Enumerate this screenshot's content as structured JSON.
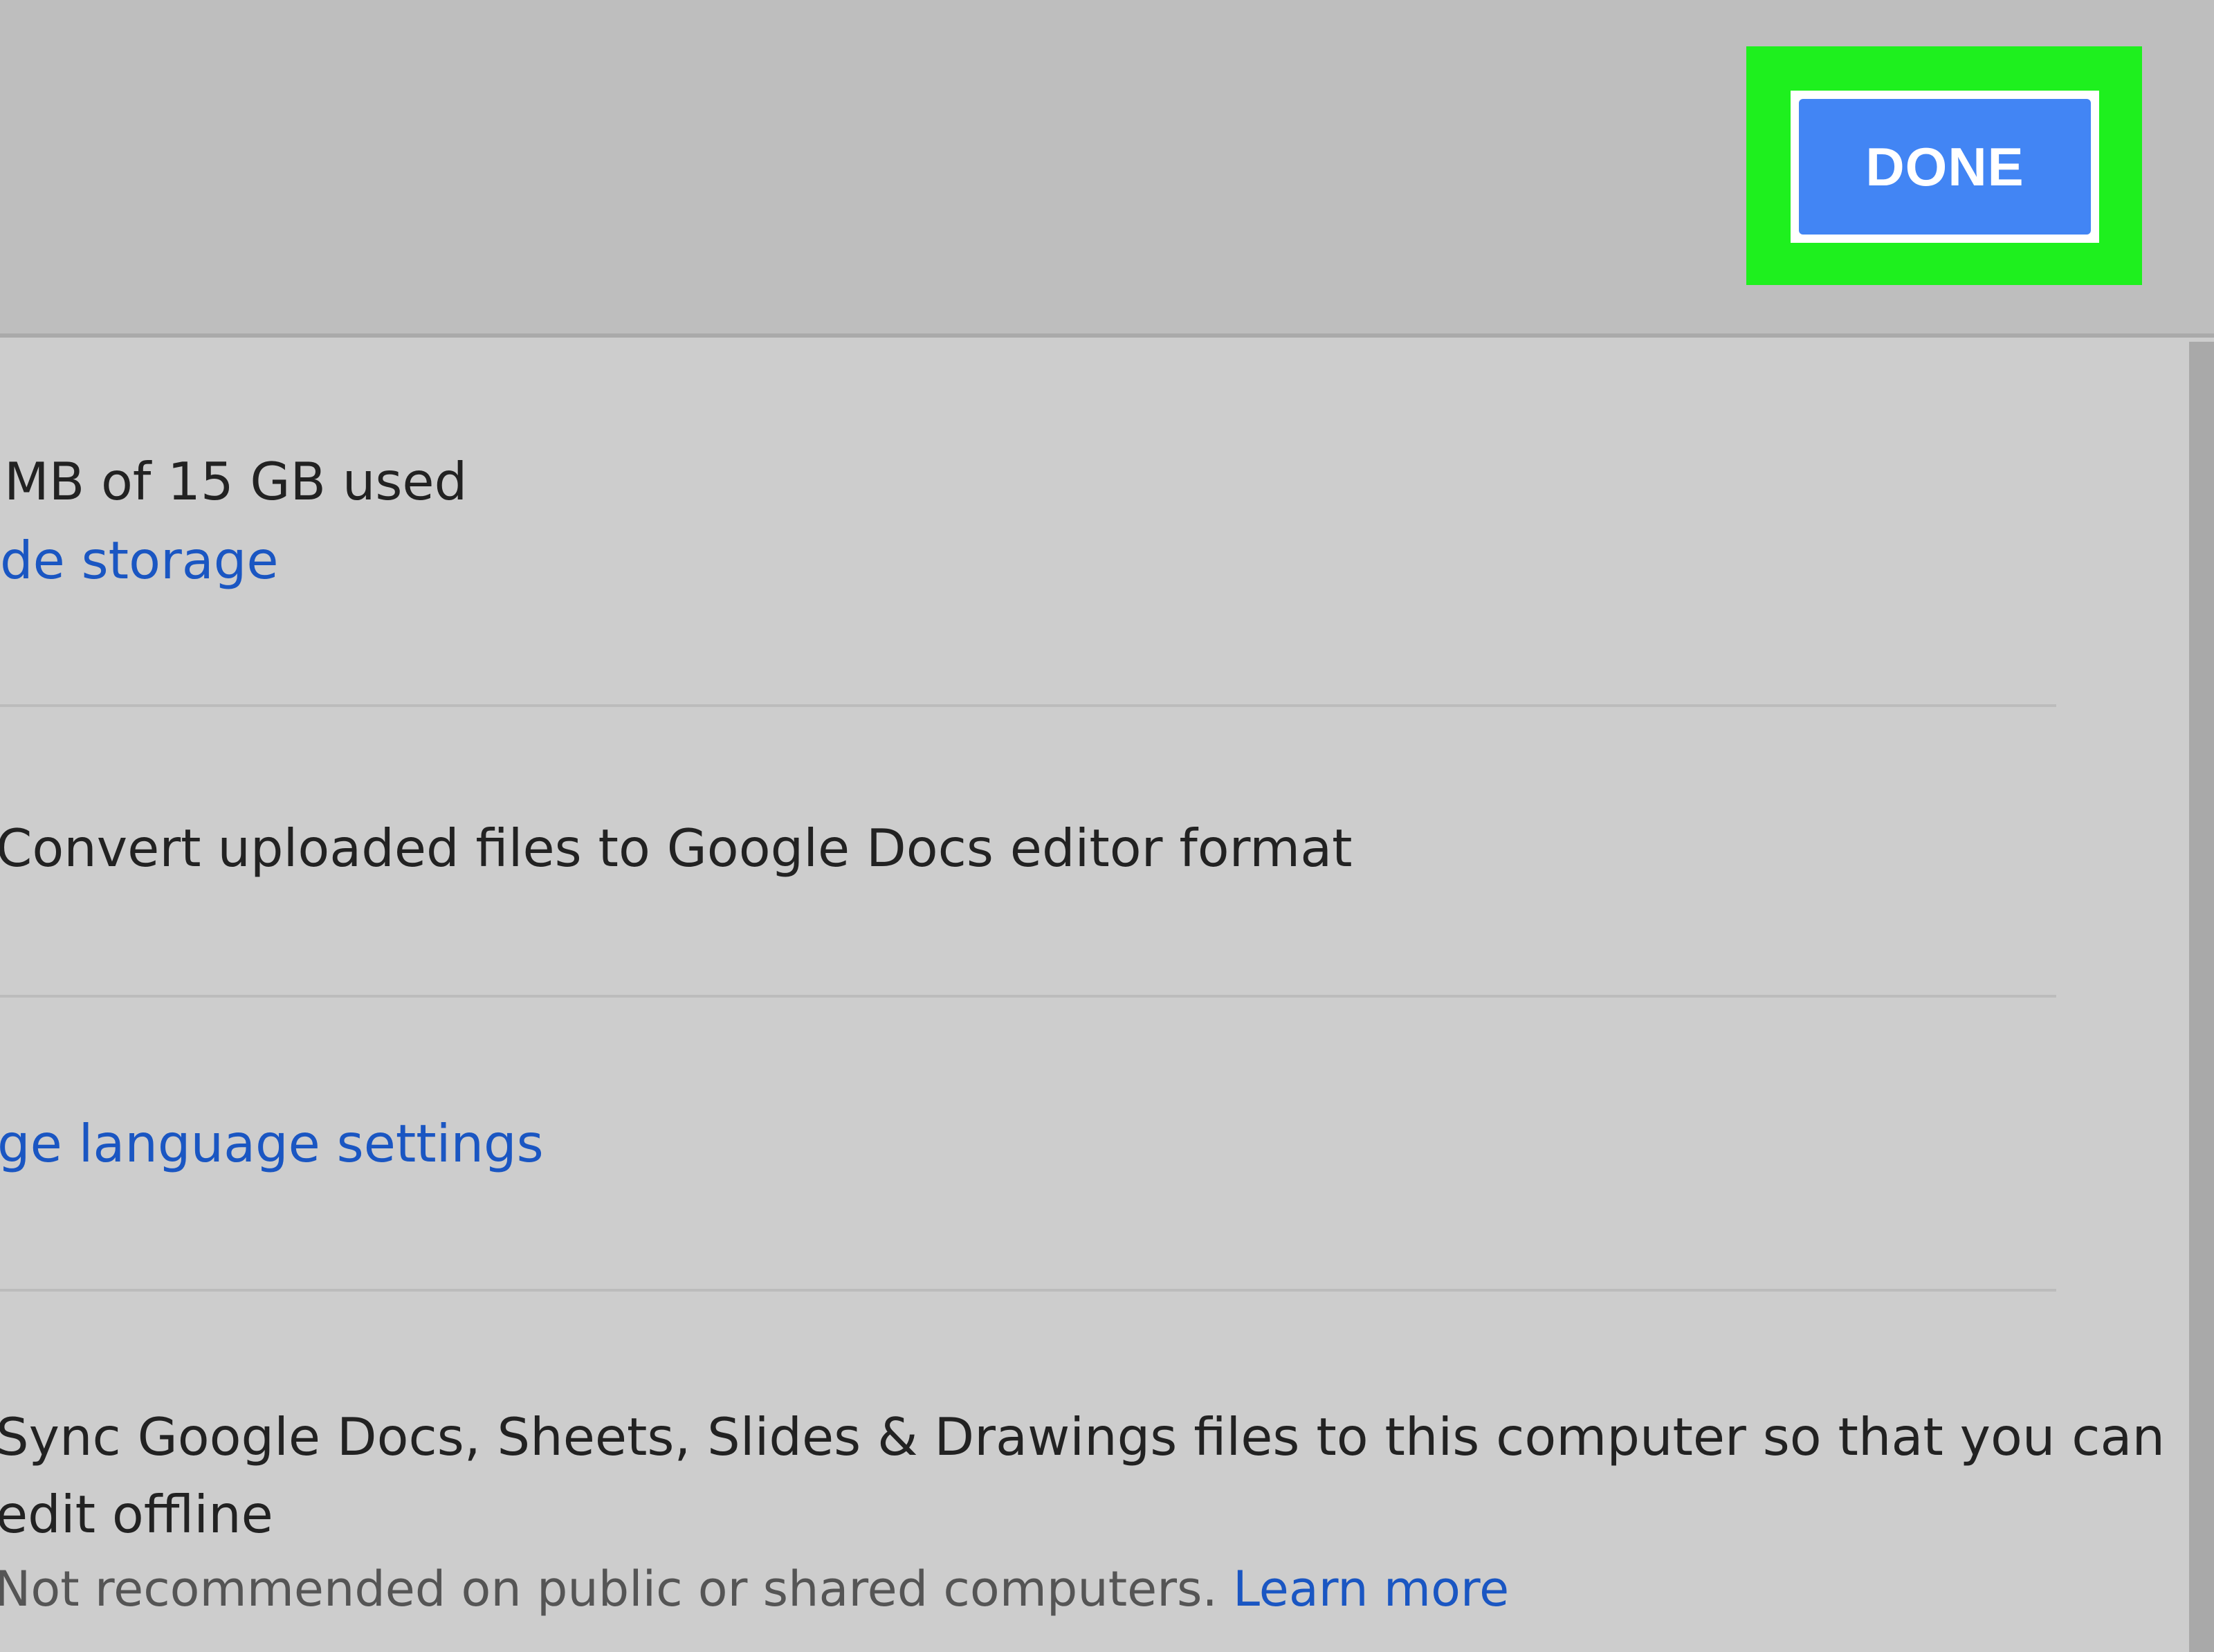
{
  "header": {
    "done_label": "DONE"
  },
  "storage": {
    "usage_text": "MB of 15 GB used",
    "upgrade_link": "de storage"
  },
  "convert": {
    "label": "Convert uploaded files to Google Docs editor format"
  },
  "language": {
    "link": "ge language settings"
  },
  "offline": {
    "line1": "Sync Google Docs, Sheets, Slides & Drawings files to this computer so that you can",
    "line2": "edit offline",
    "note": "Not recommended on public or shared computers.",
    "learn_more": "Learn more"
  },
  "colors": {
    "highlight": "#1ef01e",
    "done_button": "#4285f4",
    "link": "#1a56c2",
    "header_bg": "#bebebe",
    "content_bg": "#cdcdcd"
  }
}
